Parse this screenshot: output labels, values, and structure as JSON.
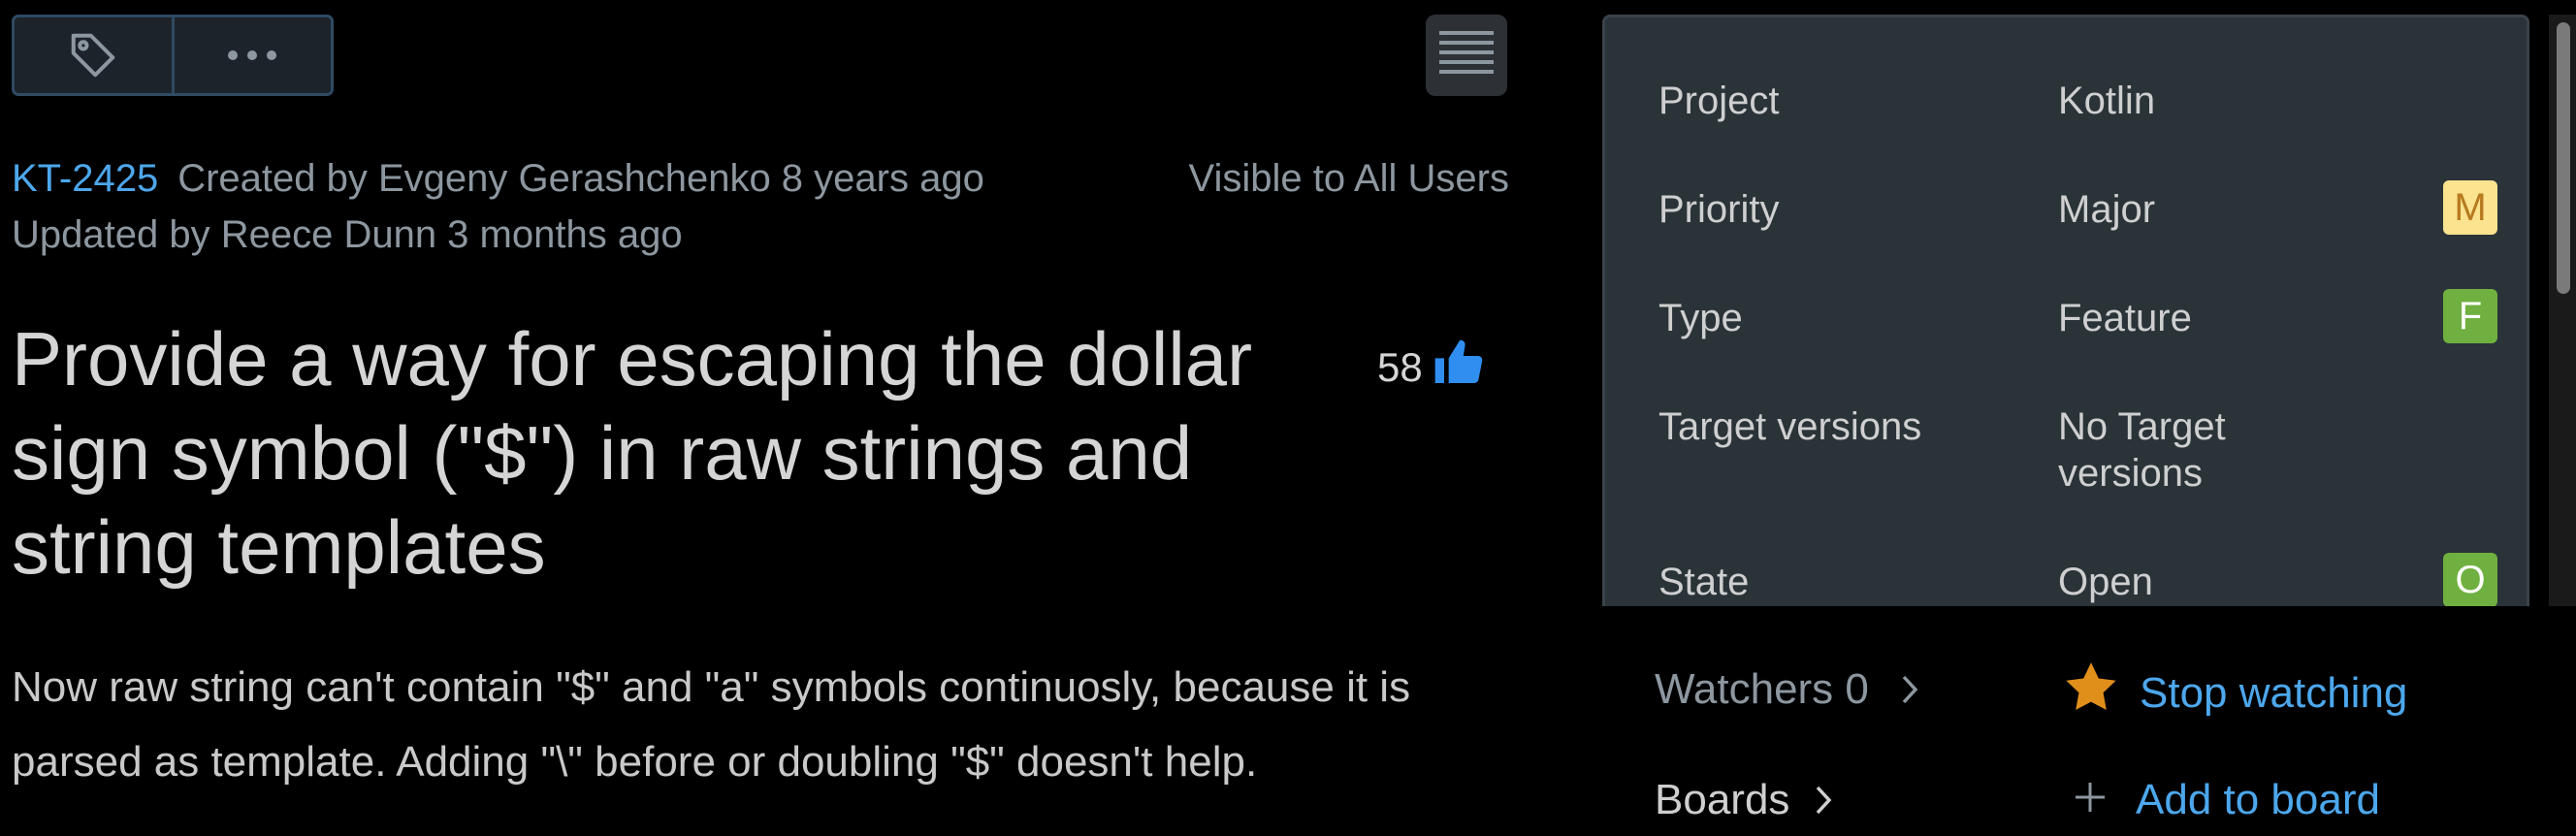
{
  "toolbar": {
    "tag_icon": "tag-icon",
    "more_icon": "more-horizontal-icon",
    "menu_icon": "list-menu-icon"
  },
  "issue": {
    "id": "KT-2425",
    "created": "Created by Evgeny Gerashchenko 8 years ago",
    "updated": "Updated by Reece Dunn 3 months ago",
    "visibility": "Visible to All Users",
    "title": "Provide a way for escaping the dollar sign symbol (\"$\") in raw strings and string templates",
    "votes": "58",
    "description": "Now raw string can't contain \"$\" and \"a\" symbols continuosly, because it is parsed as template. Adding \"\\\" before or doubling \"$\" doesn't help."
  },
  "fields": [
    {
      "label": "Project",
      "value": "Kotlin",
      "badge": ""
    },
    {
      "label": "Priority",
      "value": "Major",
      "badge": "M"
    },
    {
      "label": "Type",
      "value": "Feature",
      "badge": "F"
    },
    {
      "label": "Target versions",
      "value": "No Target versions",
      "badge": ""
    },
    {
      "label": "State",
      "value": "Open",
      "badge": "O"
    }
  ],
  "colors": {
    "accent": "#4da7ec",
    "priority_badge": "#fbe38f",
    "type_badge": "#6fb040",
    "state_badge": "#6fb040",
    "star": "#e08f1a"
  },
  "watch": {
    "watchers_label": "Watchers 0",
    "stop_label": "Stop watching",
    "star_icon": "star-icon"
  },
  "boards": {
    "label": "Boards",
    "add_label": "Add to board",
    "plus_icon": "plus-icon"
  }
}
